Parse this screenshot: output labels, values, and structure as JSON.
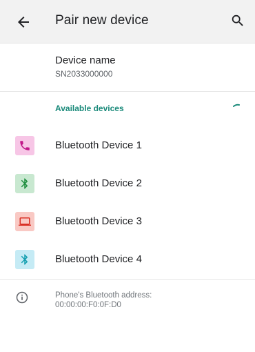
{
  "appbar": {
    "title": "Pair new device",
    "back_icon": "back-arrow-icon",
    "search_icon": "search-icon"
  },
  "device_name": {
    "label": "Device name",
    "value": "SN2033000000"
  },
  "available_devices": {
    "header": "Available devices",
    "accent_color": "#1a8a7a",
    "items": [
      {
        "label": "Bluetooth Device 1",
        "icon": "phone-icon",
        "bg": "#f7c6e6",
        "fg": "#c2188a"
      },
      {
        "label": "Bluetooth Device 2",
        "icon": "bluetooth-icon",
        "bg": "#c8e8d0",
        "fg": "#1e8e3e"
      },
      {
        "label": "Bluetooth Device 3",
        "icon": "laptop-icon",
        "bg": "#f9c9c4",
        "fg": "#d93025"
      },
      {
        "label": "Bluetooth Device 4",
        "icon": "bluetooth-icon",
        "bg": "#c5ebf5",
        "fg": "#129eaf"
      }
    ]
  },
  "footer": {
    "address_label": "Phone's Bluetooth address:",
    "address_value": "00:00:00:F0:0F:D0"
  }
}
